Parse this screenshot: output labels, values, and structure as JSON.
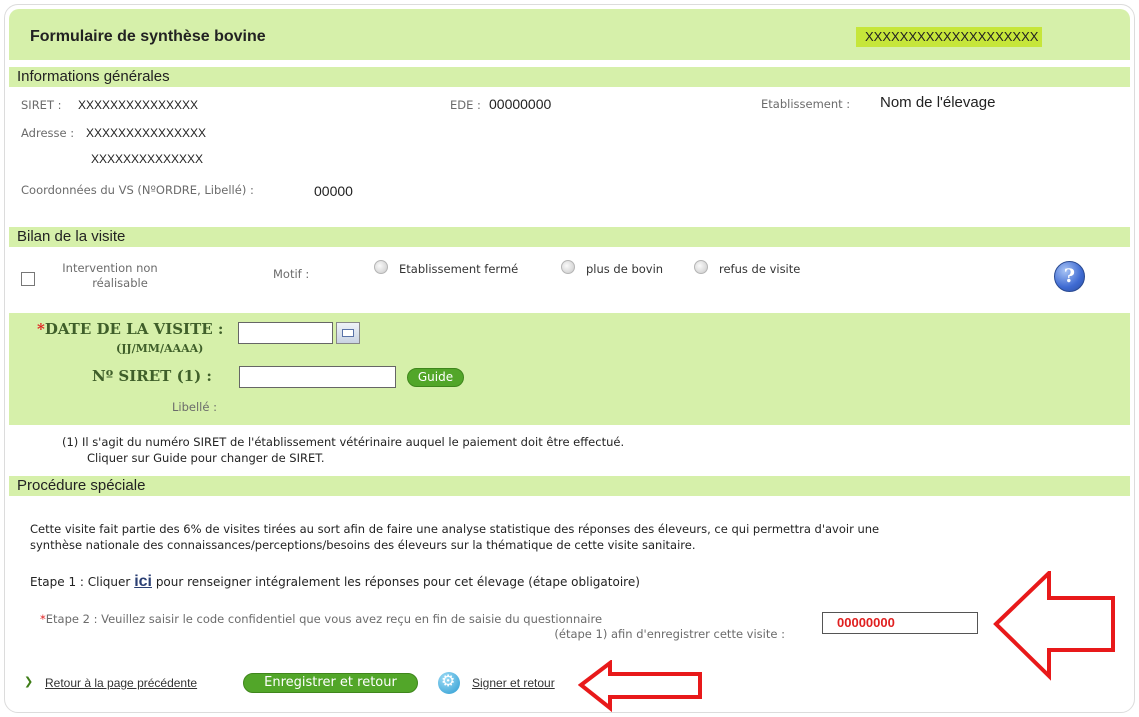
{
  "header": {
    "title": "Formulaire de synthèse bovine",
    "user": "XXXXXXXXXXXXXXXXXXXX"
  },
  "general": {
    "section_title": "Informations générales",
    "siret_label": "SIRET :",
    "siret_value": "XXXXXXXXXXXXXXX",
    "ede_label": "EDE :",
    "ede_value": "00000000",
    "etablissement_label": "Etablissement :",
    "etablissement_value": "Nom de l'élevage",
    "adresse_label": "Adresse :",
    "adresse_line1": "XXXXXXXXXXXXXXX",
    "adresse_line2": "XXXXXXXXXXXXXX",
    "vs_label": "Coordonnées du VS (NºORDRE, Libellé) :",
    "vs_value": "00000"
  },
  "bilan": {
    "section_title": "Bilan de la visite",
    "intervention_line1": "Intervention non",
    "intervention_line2": "réalisable",
    "motif_label": "Motif :",
    "motifs": [
      "Etablissement fermé",
      "plus de bovin",
      "refus de visite"
    ],
    "help_glyph": "?",
    "date_label": "DATE DE LA VISITE :",
    "date_format": "(JJ/MM/AAAA)",
    "siret_label": "Nº SIRET (1) :",
    "guide_button": "Guide",
    "libelle_label": "Libellé :",
    "footnote_line1": "(1) Il s'agit du numéro SIRET de l'établissement vétérinaire auquel le paiement doit être effectué.",
    "footnote_line2": "Cliquer sur Guide pour changer de SIRET."
  },
  "procedure": {
    "section_title": "Procédure spéciale",
    "text_line1": "Cette visite fait partie des 6% de visites tirées au sort afin de faire une analyse statistique des réponses des éleveurs, ce qui permettra d'avoir une",
    "text_line2": "synthèse nationale des connaissances/perceptions/besoins des éleveurs sur la thématique de cette visite sanitaire.",
    "etape1_prefix": "Etape 1 : Cliquer",
    "etape1_link": "ici",
    "etape1_suffix": "pour renseigner intégralement les réponses pour cet élevage (étape obligatoire)",
    "etape2_line1": "Etape 2 : Veuillez saisir le code confidentiel que vous avez reçu en fin de saisie du questionnaire",
    "etape2_line2": "(étape 1) afin d'enregistrer cette visite :",
    "code_value": "00000000"
  },
  "footer": {
    "back_link": "Retour à la page précédente",
    "save_button": "Enregistrer et retour",
    "sign_link": "Signer et retour"
  },
  "colors": {
    "section_bg": "#d6f0aa",
    "highlight": "#c6e63a",
    "button_green": "#52a629",
    "arrow_red": "#e8191a",
    "required": "#e02020"
  }
}
